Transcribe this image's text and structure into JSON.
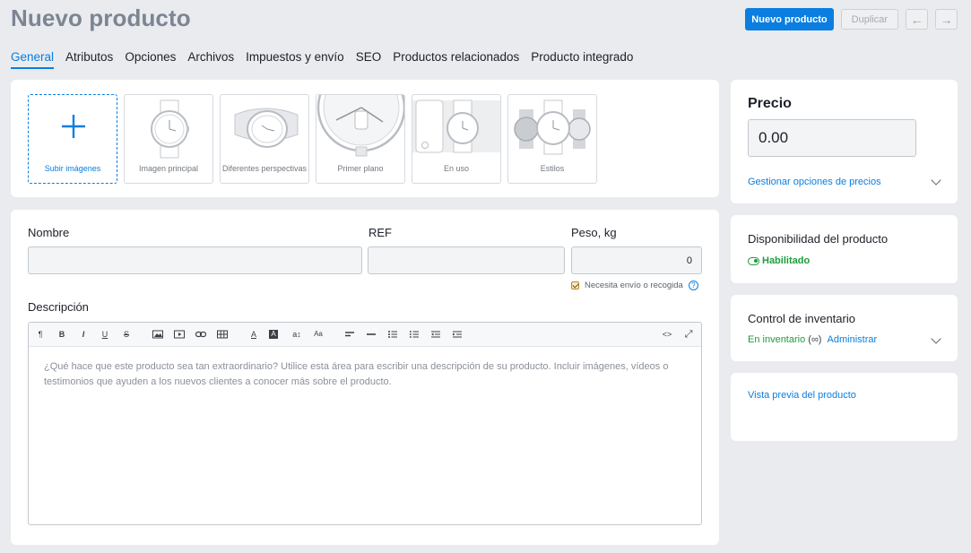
{
  "page": {
    "title": "Nuevo producto"
  },
  "actions": {
    "new_product": "Nuevo producto",
    "duplicate": "Duplicar",
    "prev": "←",
    "next": "→"
  },
  "tabs": [
    {
      "label": "General"
    },
    {
      "label": "Atributos"
    },
    {
      "label": "Opciones"
    },
    {
      "label": "Archivos"
    },
    {
      "label": "Impuestos y envío"
    },
    {
      "label": "SEO"
    },
    {
      "label": "Productos relacionados"
    },
    {
      "label": "Producto integrado"
    }
  ],
  "images": {
    "slots": [
      {
        "label": "Subir imágenes",
        "icon": "plus-icon"
      },
      {
        "label": "Imagen principal",
        "icon": "watch-front-icon"
      },
      {
        "label": "Diferentes perspectivas",
        "icon": "watch-side-icon"
      },
      {
        "label": "Primer plano",
        "icon": "watch-closeup-icon"
      },
      {
        "label": "En uso",
        "icon": "watch-in-use-icon"
      },
      {
        "label": "Estilos",
        "icon": "watch-styles-icon"
      }
    ]
  },
  "form": {
    "name_label": "Nombre",
    "name_value": "",
    "ref_label": "REF",
    "ref_value": "",
    "weight_label": "Peso, kg",
    "weight_value": "0",
    "shipping_label": "Necesita envío o recogida",
    "help": "?",
    "description_label": "Descripción",
    "description_placeholder": "¿Qué hace que este producto sea tan extraordinario? Utilice esta área para escribir una descripción de su producto. Incluir imágenes, vídeos o testimonios que ayuden a los nuevos clientes a conocer más sobre el producto.",
    "toolbar": {
      "paragraph": "¶",
      "bold": "B",
      "italic": "I",
      "underline": "U",
      "strike": "S",
      "font_color": "A",
      "bg_color": "A",
      "font_size": "a↕",
      "case": "Aa",
      "code": "<>",
      "fullscreen": "⤢"
    }
  },
  "sidebar": {
    "price": {
      "title": "Precio",
      "value": "0.00",
      "link": "Gestionar opciones de precios"
    },
    "availability": {
      "title": "Disponibilidad del producto",
      "status": "Habilitado"
    },
    "inventory": {
      "title": "Control de inventario",
      "status": "En inventario",
      "infinity": "(∞)",
      "manage": "Administrar"
    },
    "preview": {
      "link": "Vista previa del producto"
    }
  }
}
